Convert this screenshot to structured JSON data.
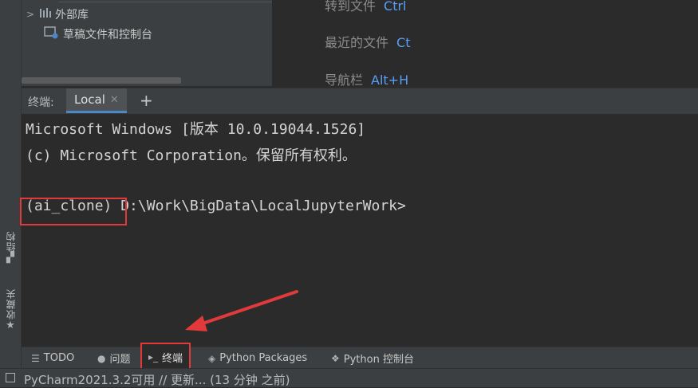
{
  "project_tree": {
    "items": [
      {
        "label": "外部库",
        "icon": "library-bars-icon"
      },
      {
        "label": "草稿文件和控制台",
        "icon": "scratch-console-icon"
      }
    ]
  },
  "hints": [
    {
      "text": "转到文件",
      "key": "Ctrl"
    },
    {
      "text": "最近的文件",
      "key": "Ct"
    },
    {
      "text": "导航栏",
      "key": "Alt+H"
    }
  ],
  "terminal": {
    "title": "终端:",
    "tabs": [
      {
        "label": "Local",
        "close_icon": "close-icon"
      }
    ],
    "lines": [
      "Microsoft Windows [版本 10.0.19044.1526]",
      "(c) Microsoft Corporation。保留所有权利。"
    ],
    "prompt_env": "(ai_clone)",
    "prompt_path": "D:\\Work\\BigData\\LocalJupyterWork>"
  },
  "left_strip": [
    {
      "label": "结构",
      "icon": "structure-icon"
    },
    {
      "label": "收藏夹",
      "icon": "star-icon"
    }
  ],
  "tool_windows": [
    {
      "label": "TODO",
      "icon": "list-icon"
    },
    {
      "label": "问题",
      "icon": "problems-icon"
    },
    {
      "label": "终端",
      "icon": "terminal-icon"
    },
    {
      "label": "Python Packages",
      "icon": "packages-icon"
    },
    {
      "label": "Python 控制台",
      "icon": "python-icon"
    }
  ],
  "status_bar": {
    "message": "PyCharm2021.3.2可用 // 更新... (13 分钟 之前)"
  },
  "colors": {
    "highlight": "#e23a3a",
    "accent": "#589df6",
    "tab_underline": "#4a88c7"
  }
}
